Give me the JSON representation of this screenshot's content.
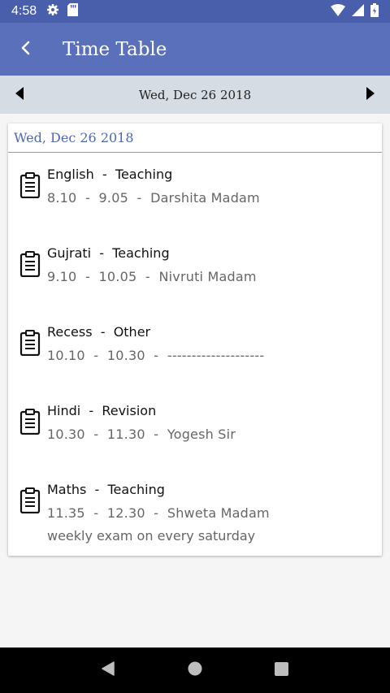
{
  "status_bar": {
    "time": "4:58",
    "icons": [
      "gear-icon",
      "sd-card-icon",
      "wifi-icon",
      "signal-icon",
      "battery-icon"
    ]
  },
  "app_bar": {
    "title": "Time Table",
    "back_icon": "chevron-left-icon"
  },
  "date_nav": {
    "date": "Wed, Dec 26 2018",
    "prev_icon": "triangle-left-icon",
    "next_icon": "triangle-right-icon"
  },
  "card": {
    "header": "Wed, Dec 26 2018",
    "entries": [
      {
        "subject": "English",
        "type": "Teaching",
        "time": "8.10  -  9.05",
        "teacher": "Darshita Madam",
        "note": ""
      },
      {
        "subject": "Gujrati",
        "type": "Teaching",
        "time": "9.10  -  10.05",
        "teacher": "Nivruti Madam",
        "note": ""
      },
      {
        "subject": "Recess",
        "type": "Other",
        "time": "10.10  -  10.30",
        "teacher": "--------------------",
        "note": ""
      },
      {
        "subject": "Hindi",
        "type": "Revision",
        "time": "10.30  -  11.30",
        "teacher": "Yogesh Sir",
        "note": ""
      },
      {
        "subject": "Maths",
        "type": "Teaching",
        "time": "11.35  -  12.30",
        "teacher": "Shweta Madam",
        "note": "weekly exam on every saturday"
      }
    ]
  },
  "nav_bar": {
    "icons": [
      "back-triangle-icon",
      "home-circle-icon",
      "recents-square-icon"
    ]
  },
  "colors": {
    "status_bar": "#4a5fab",
    "app_bar": "#5a70bb",
    "date_nav": "#d6dce4",
    "accent_text": "#4e66b3"
  }
}
